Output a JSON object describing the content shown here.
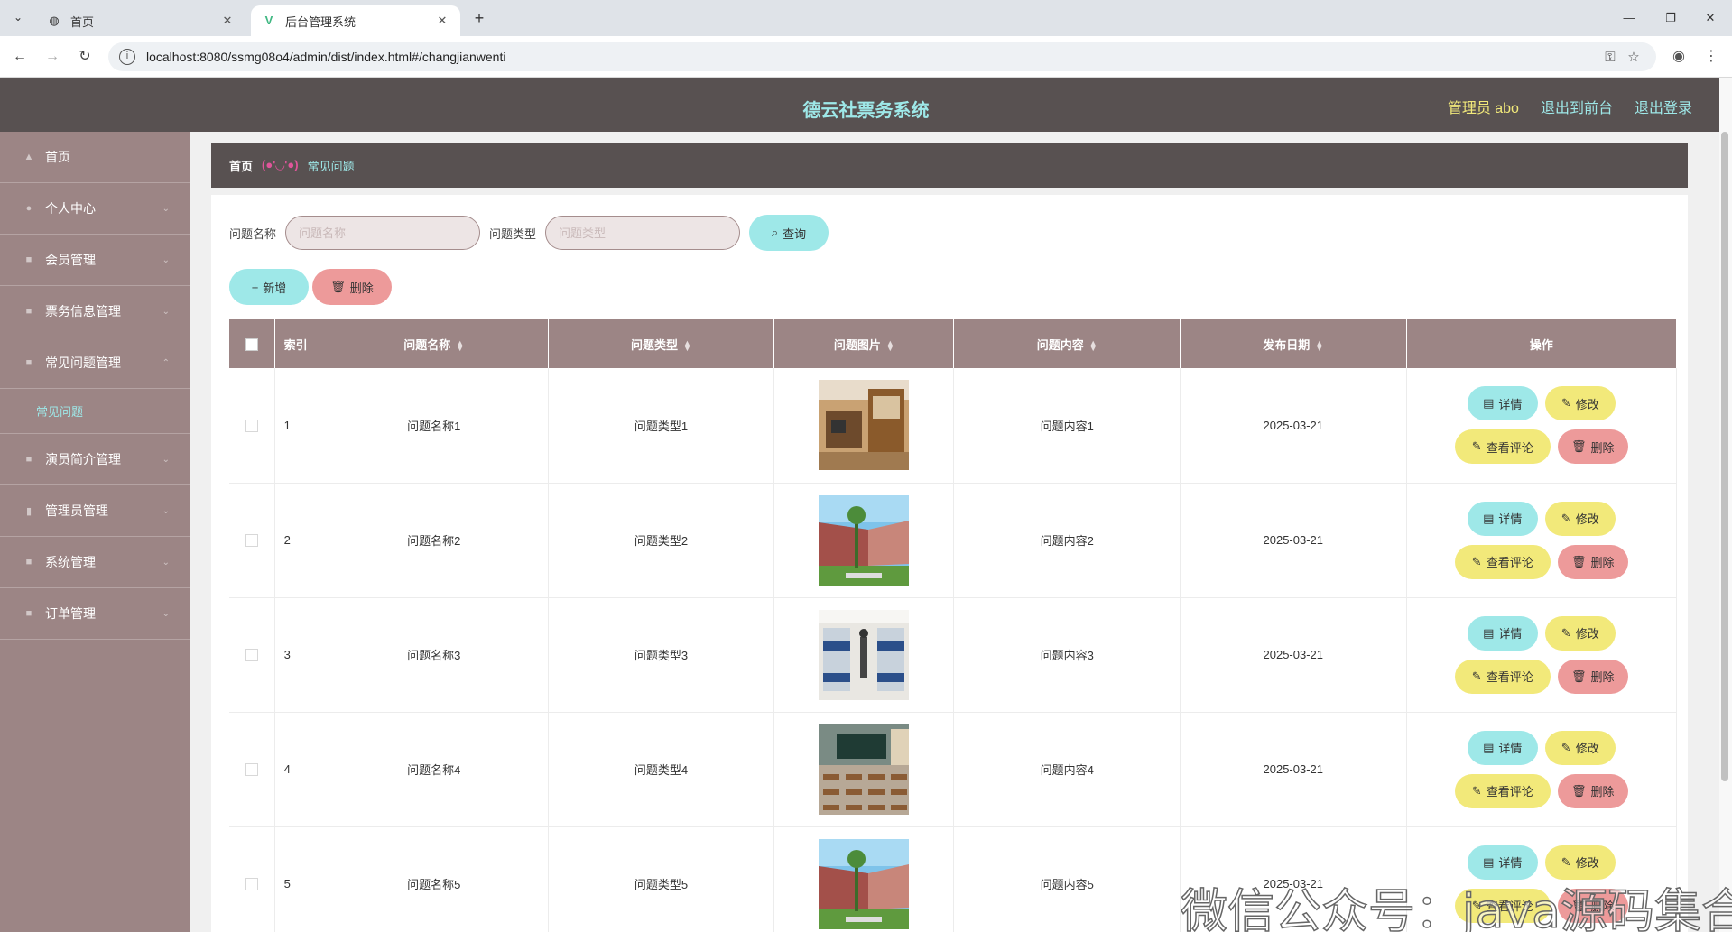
{
  "browser": {
    "tabs": [
      {
        "label": "首页",
        "icon": "globe-icon"
      },
      {
        "label": "后台管理系统",
        "icon": "vue-logo-icon"
      }
    ],
    "url": "localhost:8080/ssmg08o4/admin/dist/index.html#/changjianwenti"
  },
  "header": {
    "title": "德云社票务系统",
    "admin": "管理员 abo",
    "front": "退出到前台",
    "logout": "退出登录"
  },
  "sidebar": {
    "items": [
      {
        "label": "首页",
        "icon": "home-icon"
      },
      {
        "label": "个人中心",
        "icon": "user-icon"
      },
      {
        "label": "会员管理",
        "icon": "menu-icon"
      },
      {
        "label": "票务信息管理",
        "icon": "menu-icon"
      },
      {
        "label": "常见问题管理",
        "icon": "menu-icon"
      },
      {
        "label": "演员简介管理",
        "icon": "menu-icon"
      },
      {
        "label": "管理员管理",
        "icon": "chart-icon"
      },
      {
        "label": "系统管理",
        "icon": "menu-icon"
      },
      {
        "label": "订单管理",
        "icon": "menu-icon"
      }
    ],
    "sub_item": "常见问题"
  },
  "breadcrumb": {
    "home": "首页",
    "separator": "(●'◡'●)",
    "current": "常见问题"
  },
  "search": {
    "name_label": "问题名称",
    "name_placeholder": "问题名称",
    "type_label": "问题类型",
    "type_placeholder": "问题类型",
    "query": "查询"
  },
  "actions": {
    "add": "新增",
    "delete": "删除"
  },
  "table": {
    "headers": {
      "index": "索引",
      "name": "问题名称",
      "type": "问题类型",
      "image": "问题图片",
      "content": "问题内容",
      "date": "发布日期",
      "ops": "操作"
    },
    "ops": {
      "detail": "详情",
      "edit": "修改",
      "comment": "查看评论",
      "delete": "删除"
    },
    "rows": [
      {
        "index": "1",
        "name": "问题名称1",
        "type": "问题类型1",
        "content": "问题内容1",
        "date": "2025-03-21",
        "image": "dorm-room-photo"
      },
      {
        "index": "2",
        "name": "问题名称2",
        "type": "问题类型2",
        "content": "问题内容2",
        "date": "2025-03-21",
        "image": "campus-building-photo"
      },
      {
        "index": "3",
        "name": "问题名称3",
        "type": "问题类型3",
        "content": "问题内容3",
        "date": "2025-03-21",
        "image": "bunk-bed-room-photo"
      },
      {
        "index": "4",
        "name": "问题名称4",
        "type": "问题类型4",
        "content": "问题内容4",
        "date": "2025-03-21",
        "image": "classroom-photo"
      },
      {
        "index": "5",
        "name": "问题名称5",
        "type": "问题类型5",
        "content": "问题内容5",
        "date": "2025-03-21",
        "image": "campus-building-photo"
      }
    ]
  },
  "watermark": "微信公众号：java源码集合",
  "colors": {
    "header_bg": "#585151",
    "sidebar_bg": "#9c8585",
    "accent_cyan": "#9ee8e8",
    "accent_yellow": "#f2e97a",
    "accent_red": "#ed9a9a"
  }
}
